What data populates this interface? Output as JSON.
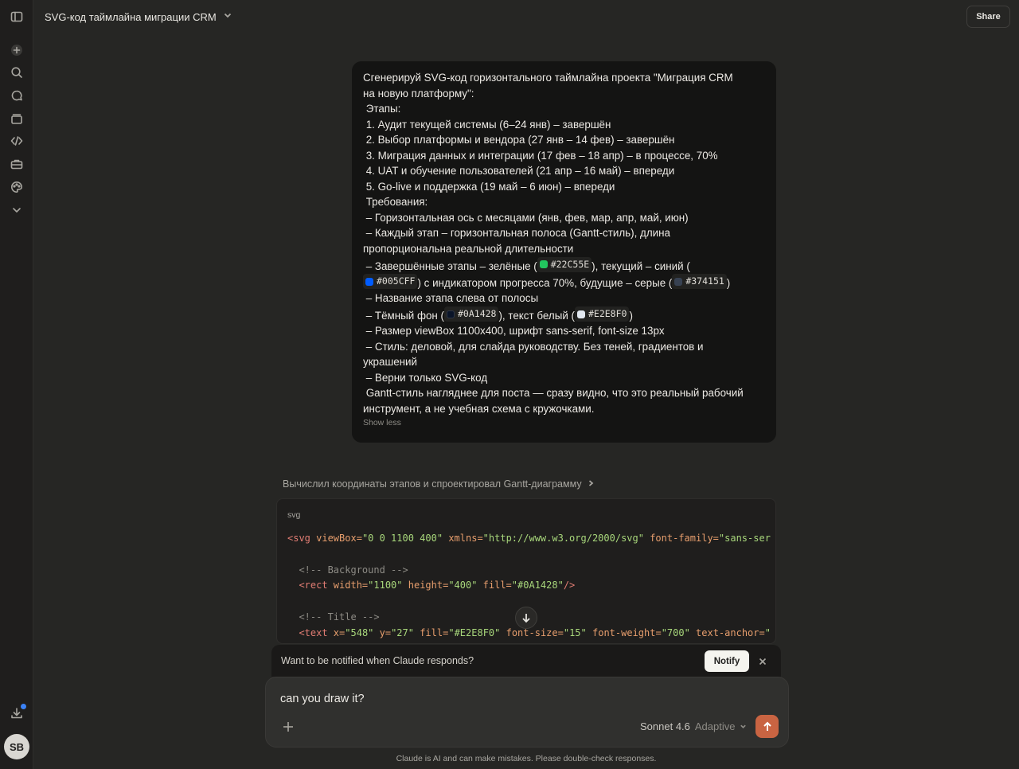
{
  "header": {
    "title": "SVG-код таймлайна миграции CRM",
    "share_label": "Share"
  },
  "sidebar": {
    "items": [
      {
        "icon": "sidebar-toggle-icon"
      },
      {
        "icon": "new-chat-icon"
      },
      {
        "icon": "search-icon"
      },
      {
        "icon": "chats-icon"
      },
      {
        "icon": "projects-icon"
      },
      {
        "icon": "code-icon"
      },
      {
        "icon": "toolbox-icon"
      },
      {
        "icon": "palette-icon"
      },
      {
        "icon": "chevron-down-icon"
      }
    ],
    "avatar_initials": "SB"
  },
  "user_message": {
    "lines": [
      "Сгенерируй SVG-код горизонтального таймлайна проекта \"Миграция CRM",
      "на новую платформу\":",
      " Этапы:",
      " 1. Аудит текущей системы (6–24 янв) – завершён",
      " 2. Выбор платформы и вендора (27 янв – 14 фев) – завершён",
      " 3. Миграция данных и интеграции (17 фев – 18 апр) – в процессе, 70%",
      " 4. UAT и обучение пользователей (21 апр – 16 май) – впереди",
      " 5. Go-live и поддержка (19 май – 6 июн) – впереди",
      " Требования:",
      " – Горизонтальная ось с месяцами (янв, фев, мар, апр, май, июн)",
      " – Каждый этап – горизонтальная полоса (Gantt-стиль), длина",
      "пропорциональна реальной длительности"
    ],
    "line_completed_prefix": " – Завершённые этапы – зелёные (",
    "line_completed_mid": "), текущий – синий (",
    "line_current_mid": ") с индикатором прогресса 70%, будущие – серые (",
    "line_current_end": ")",
    "line_after": " – Название этапа слева от полосы",
    "line_bg_prefix": " – Тёмный фон (",
    "line_bg_mid": "), текст белый (",
    "line_bg_end": ")",
    "lines_tail": [
      " – Размер viewBox 1100x400, шрифт sans-serif, font-size 13px",
      " – Стиль: деловой, для слайда руководству. Без теней, градиентов и",
      "украшений",
      " – Верни только SVG-код",
      " Gantt-стиль нагляднее для поста — сразу видно, что это реальный рабочий",
      "инструмент, а не учебная схема с кружочками."
    ],
    "colors": {
      "completed": "#22C55E",
      "current": "#005CFF",
      "future": "#374151",
      "background": "#0A1428",
      "text": "#E2E8F0"
    },
    "show_less_label": "Show less"
  },
  "thinking_summary": "Вычислил координаты этапов и спроектировал Gantt-диаграмму",
  "code_block": {
    "language": "svg",
    "line1": {
      "open": "<svg",
      "a1": " viewBox=",
      "v1": "\"0 0 1100 400\"",
      "a2": " xmlns=",
      "v2": "\"http://www.w3.org/2000/svg\"",
      "a3": " font-family=",
      "v3": "\"sans-ser"
    },
    "comment_bg": "  <!-- Background -->",
    "line_rect": {
      "open": "  <rect",
      "a1": " width=",
      "v1": "\"1100\"",
      "a2": " height=",
      "v2": "\"400\"",
      "a3": " fill=",
      "v3": "\"#0A1428\"",
      "close": "/>"
    },
    "comment_title": "  <!-- Title -->",
    "line_text": {
      "open": "  <text",
      "a1": " x=",
      "v1": "\"548\"",
      "a2": " y=",
      "v2": "\"27\"",
      "a3": " fill=",
      "v3": "\"#E2E8F0\"",
      "a4": " font-size=",
      "v4": "\"15\"",
      "a5": " font-weight=",
      "v5": "\"700\"",
      "a6": " text-anchor=",
      "v6": "\""
    }
  },
  "notify": {
    "text": "Want to be notified when Claude responds?",
    "button_label": "Notify"
  },
  "composer": {
    "value": "can you draw it?",
    "model_name": "Sonnet 4.6",
    "model_mode": "Adaptive"
  },
  "disclaimer": "Claude is AI and can make mistakes. Please double-check responses."
}
